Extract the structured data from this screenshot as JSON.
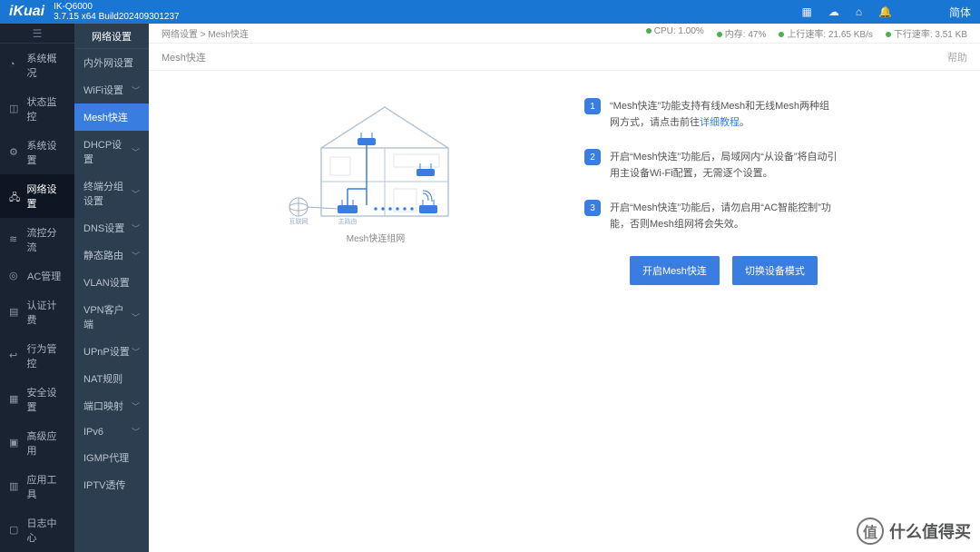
{
  "header": {
    "brand": "iKuai",
    "model": "IK-Q6000",
    "version": "3.7.15 x64 Build202409301237",
    "lang": "简体"
  },
  "sidebar1": {
    "items": [
      {
        "label": "系统概况"
      },
      {
        "label": "状态监控"
      },
      {
        "label": "系统设置"
      },
      {
        "label": "网络设置"
      },
      {
        "label": "流控分流"
      },
      {
        "label": "AC管理"
      },
      {
        "label": "认证计费"
      },
      {
        "label": "行为管控"
      },
      {
        "label": "安全设置"
      },
      {
        "label": "高级应用"
      },
      {
        "label": "应用工具"
      },
      {
        "label": "日志中心"
      }
    ],
    "active_index": 3
  },
  "sidebar2": {
    "title": "网络设置",
    "items": [
      {
        "label": "内外网设置",
        "expandable": false
      },
      {
        "label": "WiFi设置",
        "expandable": true
      },
      {
        "label": "Mesh快连",
        "expandable": false
      },
      {
        "label": "DHCP设置",
        "expandable": true
      },
      {
        "label": "终端分组设置",
        "expandable": true
      },
      {
        "label": "DNS设置",
        "expandable": true
      },
      {
        "label": "静态路由",
        "expandable": true
      },
      {
        "label": "VLAN设置",
        "expandable": false
      },
      {
        "label": "VPN客户端",
        "expandable": true
      },
      {
        "label": "UPnP设置",
        "expandable": true
      },
      {
        "label": "NAT规则",
        "expandable": false
      },
      {
        "label": "端口映射",
        "expandable": true
      },
      {
        "label": "IPv6",
        "expandable": true
      },
      {
        "label": "IGMP代理",
        "expandable": false
      },
      {
        "label": "IPTV透传",
        "expandable": false
      }
    ],
    "active_index": 2
  },
  "breadcrumb": {
    "lvl1": "网络设置",
    "sep": ">",
    "lvl2": "Mesh快连"
  },
  "stats": {
    "cpu_label": "CPU:",
    "cpu_value": "1.00%",
    "mem_label": "内存:",
    "mem_value": "47%",
    "up_label": "上行速率:",
    "up_value": "21.65 KB/s",
    "down_label": "下行速率:",
    "down_value": "3.51 KB"
  },
  "page": {
    "title": "Mesh快连",
    "help": "帮助"
  },
  "diagram": {
    "caption": "Mesh快连组网",
    "internet_label": "互联网",
    "main_router_label": "主路由"
  },
  "steps": [
    {
      "num": "1",
      "text_before": "“Mesh快连”功能支持有线Mesh和无线Mesh两种组网方式，请点击前往",
      "link": "详细教程",
      "text_after": "。"
    },
    {
      "num": "2",
      "text_before": "开启“Mesh快连”功能后，局域网内“从设备”将自动引用主设备Wi-Fi配置，无需逐个设置。",
      "link": "",
      "text_after": ""
    },
    {
      "num": "3",
      "text_before": "开启“Mesh快连”功能后，请勿启用“AC智能控制”功能，否则Mesh组网将会失效。",
      "link": "",
      "text_after": ""
    }
  ],
  "buttons": {
    "enable": "开启Mesh快连",
    "switch_mode": "切换设备模式"
  },
  "watermark": {
    "logo": "值",
    "text": "什么值得买"
  }
}
